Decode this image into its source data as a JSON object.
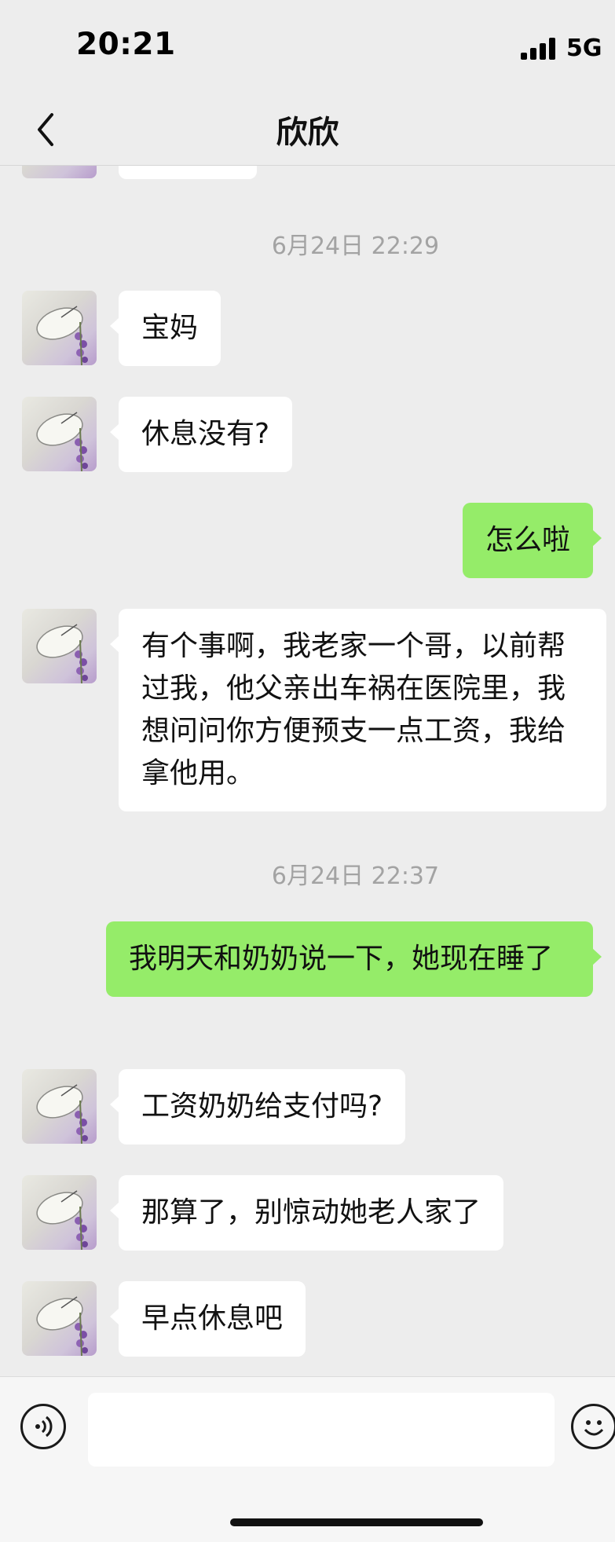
{
  "status_bar": {
    "time": "20:21",
    "network": "5G"
  },
  "nav": {
    "title": "欣欣"
  },
  "messages": [
    {
      "kind": "time",
      "text": "6月24日 22:29"
    },
    {
      "kind": "in",
      "text": "宝妈"
    },
    {
      "kind": "in",
      "text": "休息没有?"
    },
    {
      "kind": "out",
      "text": "怎么啦"
    },
    {
      "kind": "in",
      "text": "有个事啊，我老家一个哥，以前帮过我，他父亲出车祸在医院里，我想问问你方便预支一点工资，我给拿他用。"
    },
    {
      "kind": "time",
      "text": "6月24日 22:37"
    },
    {
      "kind": "out",
      "text": "我明天和奶奶说一下，她现在睡了"
    },
    {
      "kind": "in",
      "text": "工资奶奶给支付吗?"
    },
    {
      "kind": "in",
      "text": "那算了，别惊动她老人家了"
    },
    {
      "kind": "in",
      "text": "早点休息吧"
    }
  ],
  "input": {
    "value": ""
  },
  "icons": {
    "back": "chevron-left-icon",
    "voice": "voice-icon",
    "emoji": "emoji-icon",
    "avatar": "butterfly-lavender-photo"
  },
  "colors": {
    "background": "#ededed",
    "incoming_bubble": "#ffffff",
    "outgoing_bubble": "#95ec69"
  }
}
